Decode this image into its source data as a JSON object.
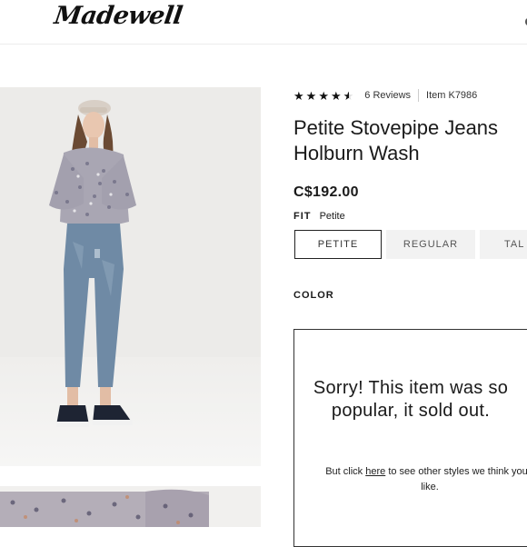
{
  "header": {
    "logo": "Madewell"
  },
  "rating": {
    "stars": 4.5,
    "reviews": "6 Reviews",
    "item": "Item K7986"
  },
  "product": {
    "title_line1": "Petite Stovepipe Jeans",
    "title_line2": "Holburn Wash",
    "price": "C$192.00"
  },
  "fit": {
    "label": "FIT",
    "selected": "Petite",
    "options": [
      "PETITE",
      "REGULAR",
      "TAL"
    ]
  },
  "color": {
    "label": "COLOR"
  },
  "sold_out": {
    "message": "Sorry! This item was so popular, it sold out.",
    "sub_before": "But click ",
    "sub_link": "here",
    "sub_after": " to see other styles we think you'll like."
  },
  "colors": {
    "text": "#1a1a1a",
    "button_bg": "#f2f2f2",
    "photo_bg": "#ecebe9"
  }
}
